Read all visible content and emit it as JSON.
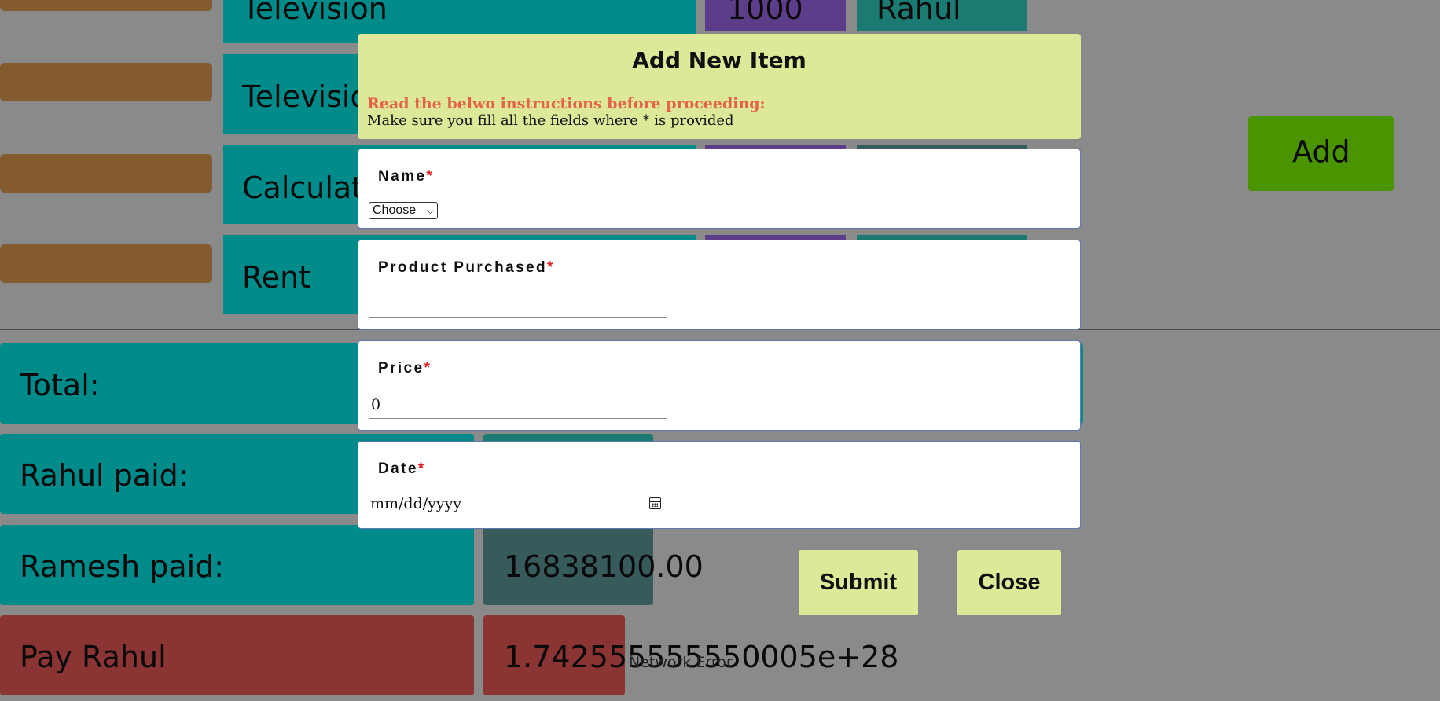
{
  "background": {
    "product_rows": [
      "Television",
      "Televisio",
      "Calculato",
      "Rent"
    ],
    "row0_price": "1000",
    "row0_person": "Rahul",
    "add_button": "Add",
    "summary": {
      "total_label": "Total:",
      "rahul_paid_label": "Rahul paid:",
      "ramesh_paid_label": "Ramesh paid:",
      "ramesh_paid_value": "16838100.00",
      "pay_label": "Pay Rahul",
      "pay_value": "1.742555555550005e+28"
    },
    "network_error": "Network Error"
  },
  "modal": {
    "title": "Add New Item",
    "instruction_heading": "Read the belwo instructions before proceeding:",
    "instruction_text": "Make sure you fill all the fields where * is provided",
    "required_mark": "*",
    "fields": {
      "name": {
        "label": "Name",
        "selected": "Choose"
      },
      "product": {
        "label": "Product Purchased",
        "value": ""
      },
      "price": {
        "label": "Price",
        "value": "0"
      },
      "date": {
        "label": "Date",
        "placeholder": "mm/dd/yyyy"
      }
    },
    "submit_label": "Submit",
    "close_label": "Close"
  },
  "colors": {
    "overlay": "#8a8a8a",
    "modal_header": "#dde898",
    "instruction_red": "#e4624a",
    "required_red": "#e02020",
    "cyan_row": "#008b8b",
    "add_green": "#4a9400"
  }
}
